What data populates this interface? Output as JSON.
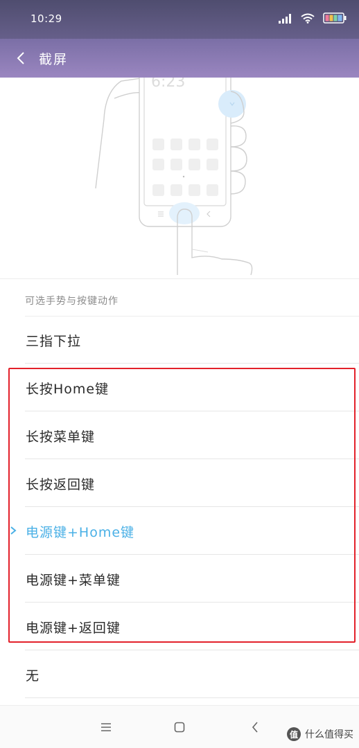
{
  "status_bar": {
    "time": "10:29",
    "icons": [
      "signal-icon",
      "wifi-icon",
      "battery-icon"
    ]
  },
  "app_bar": {
    "title": "截屏",
    "back_icon": "back-arrow-icon"
  },
  "illustration": {
    "phone_clock": "6:23"
  },
  "section": {
    "header": "可选手势与按键动作"
  },
  "options": [
    {
      "label": "三指下拉",
      "selected": false
    },
    {
      "label": "长按Home键",
      "selected": false
    },
    {
      "label": "长按菜单键",
      "selected": false
    },
    {
      "label": "长按返回键",
      "selected": false
    },
    {
      "label": "电源键+Home键",
      "selected": true
    },
    {
      "label": "电源键+菜单键",
      "selected": false
    },
    {
      "label": "电源键+返回键",
      "selected": false
    },
    {
      "label": "无",
      "selected": false
    }
  ],
  "nav_bar": {
    "icons": [
      "menu-icon",
      "home-icon",
      "back-icon"
    ]
  },
  "watermark": {
    "badge": "值",
    "text": "什么值得买"
  },
  "colors": {
    "accent": "#4ab0e6",
    "highlight_border": "#e3202a",
    "status_bar": "#4f4d6f",
    "app_bar": "#9a86c0"
  }
}
